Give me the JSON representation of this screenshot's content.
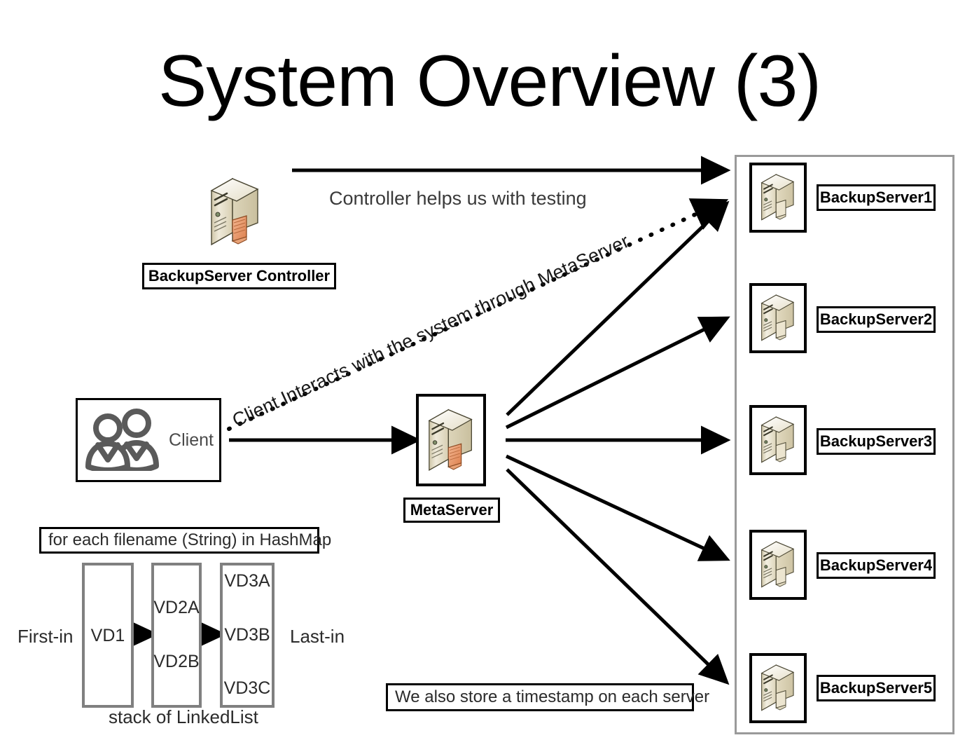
{
  "title": "System Overview (3)",
  "annotations": {
    "controller_testing": "Controller helps us with testing",
    "client_interacts": "Client Interacts with the system through MetaServer",
    "timestamp_note": "We also store a timestamp on each server",
    "hashmap_note": "for each filename (String) in HashMap",
    "stack_caption": "stack of LinkedList",
    "first_in": "First-in",
    "last_in": "Last-in"
  },
  "nodes": {
    "controller": {
      "label": "BackupServer Controller",
      "icon": "server-icon"
    },
    "client": {
      "label": "Client",
      "icon": "users-icon"
    },
    "metaserver": {
      "label": "MetaServer",
      "icon": "server-icon"
    }
  },
  "backup_servers": [
    {
      "label": "BackupServer1",
      "icon": "server-icon"
    },
    {
      "label": "BackupServer2",
      "icon": "server-icon"
    },
    {
      "label": "BackupServer3",
      "icon": "server-icon"
    },
    {
      "label": "BackupServer4",
      "icon": "server-icon"
    },
    {
      "label": "BackupServer5",
      "icon": "server-icon"
    }
  ],
  "stack": {
    "columns": [
      {
        "items": [
          "VD1"
        ]
      },
      {
        "items": [
          "VD2A",
          "VD2B"
        ]
      },
      {
        "items": [
          "VD3A",
          "VD3B",
          "VD3C"
        ]
      }
    ]
  },
  "colors": {
    "background": "#ffffff",
    "stroke": "#000000",
    "group_border": "#9a9a9a",
    "stack_border": "#808080",
    "server_body": "#e8e2cf",
    "server_top": "#f7f4ea",
    "server_side": "#d8d0b4",
    "server_accent": "#e8956b",
    "client_gray": "#5a5a5a",
    "text": "#000000"
  }
}
